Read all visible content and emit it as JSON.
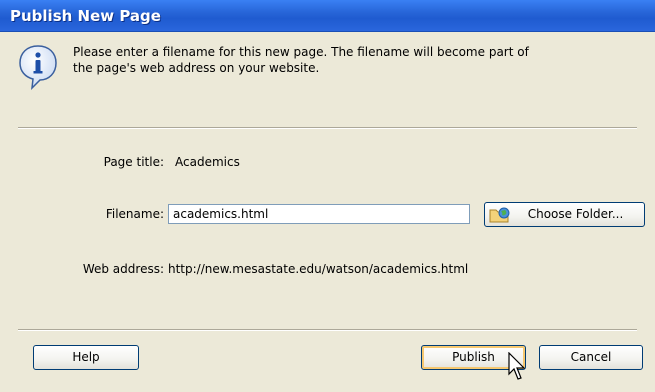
{
  "window": {
    "title": "Publish New Page"
  },
  "info": {
    "icon": "info-icon",
    "line1": "Please enter a filename for this new page. The filename will become part of",
    "line2": "the page's web address on your website."
  },
  "form": {
    "page_title_label": "Page title:",
    "page_title_value": "Academics",
    "filename_label": "Filename:",
    "filename_value": "academics.html",
    "choose_folder_label": "Choose Folder...",
    "web_address_label": "Web address:",
    "web_address_value": "http://new.mesastate.edu/watson/academics.html"
  },
  "buttons": {
    "help": "Help",
    "publish": "Publish",
    "cancel": "Cancel"
  },
  "colors": {
    "titlebar": "#2765d8",
    "dialog_bg": "#ece9d8",
    "default_button_glow": "#f6c870"
  }
}
